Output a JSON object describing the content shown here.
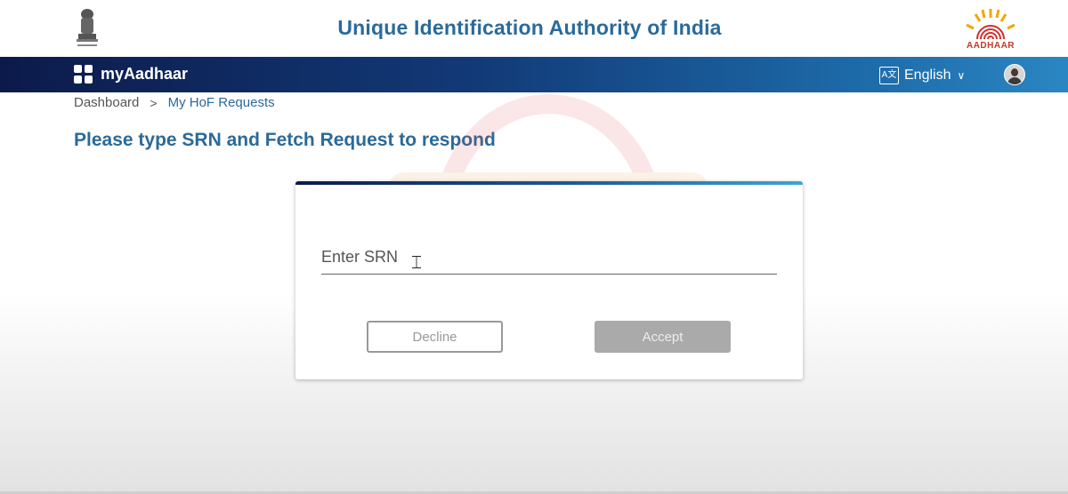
{
  "header": {
    "title": "Unique Identification Authority of India",
    "emblem_icon": "national-emblem-icon",
    "logo_icon": "aadhaar-logo-icon",
    "logo_text": "AADHAAR"
  },
  "navbar": {
    "brand": "myAadhaar",
    "brand_icon": "grid-apps-icon",
    "language": "English",
    "language_icon": "translate-icon",
    "avatar_icon": "user-avatar-icon"
  },
  "breadcrumb": {
    "items": [
      "Dashboard",
      "My HoF Requests"
    ]
  },
  "page": {
    "heading": "Please type SRN and Fetch Request to respond"
  },
  "form": {
    "srn_placeholder": "Enter SRN",
    "srn_value": "",
    "decline_label": "Decline",
    "accept_label": "Accept"
  },
  "colors": {
    "accent": "#2a6a9a",
    "nav_start": "#0c1a4a",
    "nav_end": "#2a86c2",
    "disabled_button": "#aaaaaa"
  }
}
